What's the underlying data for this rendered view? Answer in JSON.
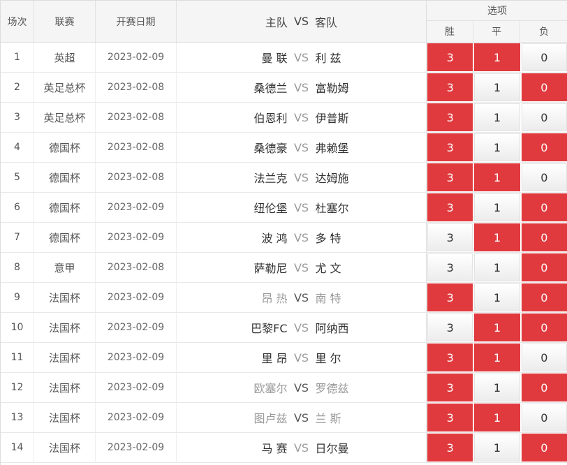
{
  "header": {
    "idx": "场次",
    "league": "联赛",
    "date": "开赛日期",
    "home": "主队",
    "vs": "VS",
    "away": "客队",
    "options_title": "选项",
    "win": "胜",
    "draw": "平",
    "lose": "负"
  },
  "colors": {
    "selected": "#e03a3e",
    "header_bg": "#f5f5f5",
    "dim_text": "#9a9a9a"
  },
  "rows": [
    {
      "idx": "1",
      "league": "英超",
      "date": "2023-02-09",
      "home": "曼 联",
      "vs": "VS",
      "away": "利 兹",
      "dim": false,
      "opts": [
        {
          "label": "3",
          "selected": true
        },
        {
          "label": "1",
          "selected": true
        },
        {
          "label": "0",
          "selected": false
        }
      ]
    },
    {
      "idx": "2",
      "league": "英足总杯",
      "date": "2023-02-08",
      "home": "桑德兰",
      "vs": "VS",
      "away": "富勒姆",
      "dim": false,
      "opts": [
        {
          "label": "3",
          "selected": true
        },
        {
          "label": "1",
          "selected": false
        },
        {
          "label": "0",
          "selected": true
        }
      ]
    },
    {
      "idx": "3",
      "league": "英足总杯",
      "date": "2023-02-08",
      "home": "伯恩利",
      "vs": "VS",
      "away": "伊普斯",
      "dim": false,
      "opts": [
        {
          "label": "3",
          "selected": true
        },
        {
          "label": "1",
          "selected": false
        },
        {
          "label": "0",
          "selected": false
        }
      ]
    },
    {
      "idx": "4",
      "league": "德国杯",
      "date": "2023-02-08",
      "home": "桑德豪",
      "vs": "VS",
      "away": "弗赖堡",
      "dim": false,
      "opts": [
        {
          "label": "3",
          "selected": true
        },
        {
          "label": "1",
          "selected": false
        },
        {
          "label": "0",
          "selected": true
        }
      ]
    },
    {
      "idx": "5",
      "league": "德国杯",
      "date": "2023-02-08",
      "home": "法兰克",
      "vs": "VS",
      "away": "达姆施",
      "dim": false,
      "opts": [
        {
          "label": "3",
          "selected": true
        },
        {
          "label": "1",
          "selected": true
        },
        {
          "label": "0",
          "selected": false
        }
      ]
    },
    {
      "idx": "6",
      "league": "德国杯",
      "date": "2023-02-09",
      "home": "纽伦堡",
      "vs": "VS",
      "away": "杜塞尔",
      "dim": false,
      "opts": [
        {
          "label": "3",
          "selected": true
        },
        {
          "label": "1",
          "selected": false
        },
        {
          "label": "0",
          "selected": true
        }
      ]
    },
    {
      "idx": "7",
      "league": "德国杯",
      "date": "2023-02-09",
      "home": "波 鸿",
      "vs": "VS",
      "away": "多 特",
      "dim": false,
      "opts": [
        {
          "label": "3",
          "selected": false
        },
        {
          "label": "1",
          "selected": true
        },
        {
          "label": "0",
          "selected": true
        }
      ]
    },
    {
      "idx": "8",
      "league": "意甲",
      "date": "2023-02-08",
      "home": "萨勒尼",
      "vs": "VS",
      "away": "尤 文",
      "dim": false,
      "opts": [
        {
          "label": "3",
          "selected": false
        },
        {
          "label": "1",
          "selected": false
        },
        {
          "label": "0",
          "selected": true
        }
      ]
    },
    {
      "idx": "9",
      "league": "法国杯",
      "date": "2023-02-09",
      "home": "昂 热",
      "vs": "VS",
      "away": "南 特",
      "dim": true,
      "opts": [
        {
          "label": "3",
          "selected": true
        },
        {
          "label": "1",
          "selected": false
        },
        {
          "label": "0",
          "selected": true
        }
      ]
    },
    {
      "idx": "10",
      "league": "法国杯",
      "date": "2023-02-09",
      "home": "巴黎FC",
      "vs": "VS",
      "away": "阿纳西",
      "dim": false,
      "opts": [
        {
          "label": "3",
          "selected": false
        },
        {
          "label": "1",
          "selected": true
        },
        {
          "label": "0",
          "selected": true
        }
      ]
    },
    {
      "idx": "11",
      "league": "法国杯",
      "date": "2023-02-09",
      "home": "里 昂",
      "vs": "VS",
      "away": "里 尔",
      "dim": false,
      "opts": [
        {
          "label": "3",
          "selected": true
        },
        {
          "label": "1",
          "selected": true
        },
        {
          "label": "0",
          "selected": false
        }
      ]
    },
    {
      "idx": "12",
      "league": "法国杯",
      "date": "2023-02-09",
      "home": "欧塞尔",
      "vs": "VS",
      "away": "罗德兹",
      "dim": true,
      "opts": [
        {
          "label": "3",
          "selected": true
        },
        {
          "label": "1",
          "selected": false
        },
        {
          "label": "0",
          "selected": true
        }
      ]
    },
    {
      "idx": "13",
      "league": "法国杯",
      "date": "2023-02-09",
      "home": "图卢兹",
      "vs": "VS",
      "away": "兰 斯",
      "dim": true,
      "opts": [
        {
          "label": "3",
          "selected": true
        },
        {
          "label": "1",
          "selected": true
        },
        {
          "label": "0",
          "selected": false
        }
      ]
    },
    {
      "idx": "14",
      "league": "法国杯",
      "date": "2023-02-09",
      "home": "马 赛",
      "vs": "VS",
      "away": "日尔曼",
      "dim": false,
      "opts": [
        {
          "label": "3",
          "selected": true
        },
        {
          "label": "1",
          "selected": false
        },
        {
          "label": "0",
          "selected": true
        }
      ]
    }
  ]
}
